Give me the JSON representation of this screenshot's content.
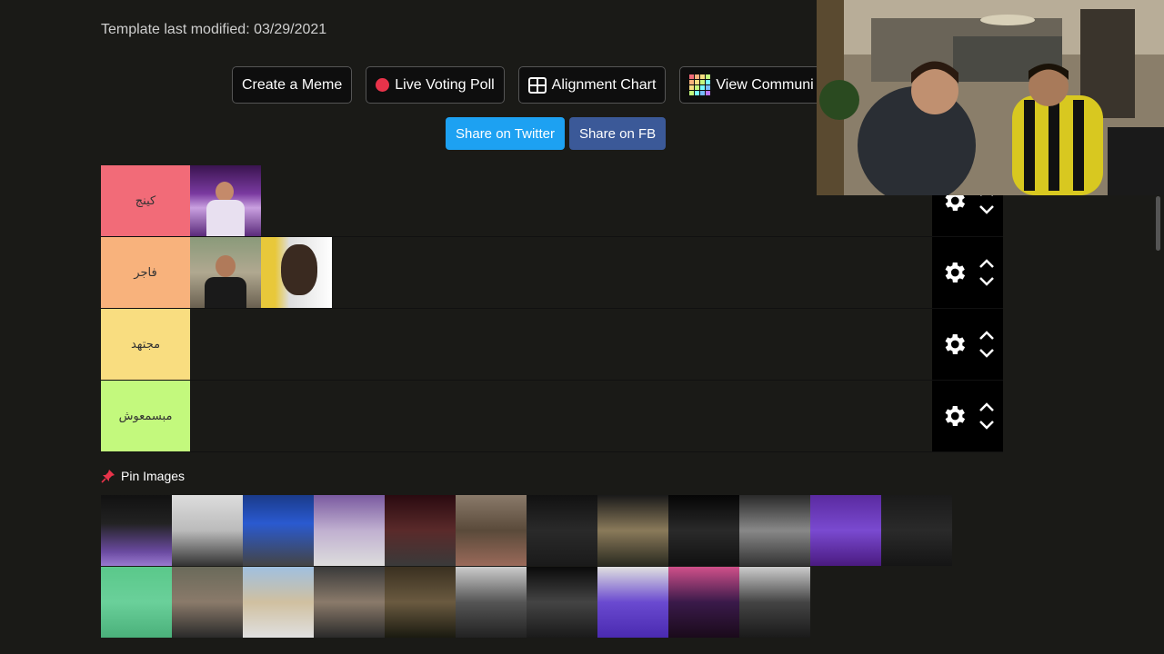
{
  "header": {
    "modified": "Template last modified: 03/29/2021"
  },
  "buttons": {
    "create_meme": "Create a Meme",
    "live_poll": "Live Voting Poll",
    "alignment": "Alignment Chart",
    "community": "View Communi"
  },
  "share": {
    "twitter": "Share on Twitter",
    "facebook": "Share on FB"
  },
  "tiers": [
    {
      "label": "كينج",
      "color": "#f26b78"
    },
    {
      "label": "فاجر",
      "color": "#f8b27c"
    },
    {
      "label": "مجتهد",
      "color": "#f9dd80"
    },
    {
      "label": "مبسمعوش",
      "color": "#c3f97d"
    }
  ],
  "pin": {
    "label": "Pin Images"
  },
  "colors": {
    "twitter": "#1da1f2",
    "facebook": "#3b5998",
    "poll_dot": "#e8334a"
  }
}
